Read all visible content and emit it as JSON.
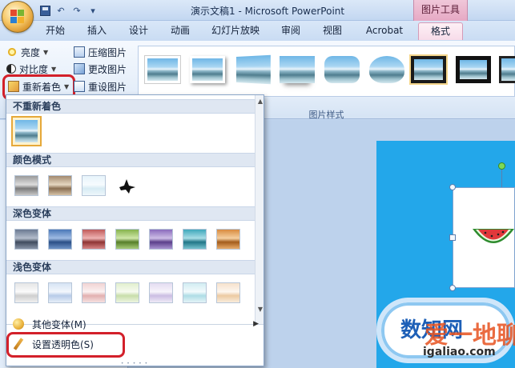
{
  "window": {
    "title": "演示文稿1 - Microsoft PowerPoint",
    "context_tools": "图片工具"
  },
  "qat": {
    "icons": [
      "save-icon",
      "undo-icon",
      "redo-icon",
      "customize-icon"
    ]
  },
  "tabs": [
    {
      "label": "开始"
    },
    {
      "label": "插入"
    },
    {
      "label": "设计"
    },
    {
      "label": "动画"
    },
    {
      "label": "幻灯片放映"
    },
    {
      "label": "审阅"
    },
    {
      "label": "视图"
    },
    {
      "label": "Acrobat"
    },
    {
      "label": "格式",
      "active": true
    }
  ],
  "ribbon": {
    "adjust": {
      "brightness": "亮度",
      "contrast": "对比度",
      "recolor": "重新着色",
      "compress": "压缩图片",
      "change": "更改图片",
      "reset": "重设图片"
    },
    "styles_group_label": "图片样式"
  },
  "recolor_menu": {
    "sections": [
      {
        "title": "不重新着色",
        "count": 1
      },
      {
        "title": "颜色模式",
        "count": 4
      },
      {
        "title": "深色变体",
        "count": 7
      },
      {
        "title": "浅色变体",
        "count": 7
      }
    ],
    "more_variants": "其他变体(M)",
    "set_transparent": "设置透明色(S)"
  },
  "slide": {
    "cloud_text": "数知网"
  },
  "watermark": {
    "text": "爱一地聊",
    "url": "igaliao.com"
  },
  "colors": {
    "highlight": "#d3202a",
    "slide_bg": "#23a7ea",
    "context_tab": "#e6a9c4"
  }
}
